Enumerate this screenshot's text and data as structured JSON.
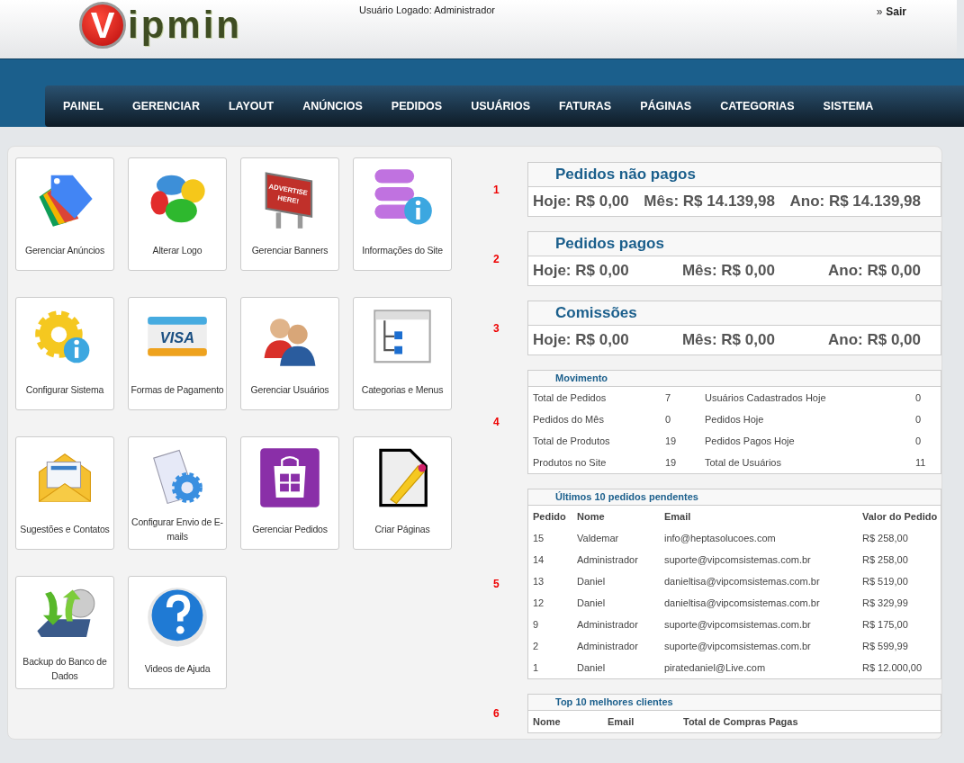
{
  "header": {
    "logo": {
      "mark": "V",
      "text": "ipmin"
    },
    "logged_user": "Usuário Logado: Administrador",
    "logout": {
      "arrow": "»",
      "label": "Sair"
    }
  },
  "nav": [
    {
      "label": "PAINEL"
    },
    {
      "label": "GERENCIAR"
    },
    {
      "label": "LAYOUT"
    },
    {
      "label": "ANÚNCIOS"
    },
    {
      "label": "PEDIDOS"
    },
    {
      "label": "USUÁRIOS"
    },
    {
      "label": "FATURAS"
    },
    {
      "label": "PÁGINAS"
    },
    {
      "label": "CATEGORIAS"
    },
    {
      "label": "SISTEMA"
    }
  ],
  "tiles": [
    {
      "label": "Gerenciar Anúncios",
      "kind": "tag"
    },
    {
      "label": "Alterar Logo",
      "kind": "paint"
    },
    {
      "label": "Gerenciar Banners",
      "kind": "billboard",
      "icon_text": [
        "ADVERTISE",
        "HERE!"
      ]
    },
    {
      "label": "Informações do Site",
      "kind": "database-info"
    },
    {
      "label": "Configurar Sistema",
      "kind": "gear-info"
    },
    {
      "label": "Formas de Pagamento",
      "kind": "card",
      "icon_text": [
        "VISA"
      ]
    },
    {
      "label": "Gerenciar Usuários",
      "kind": "users"
    },
    {
      "label": "Categorias e Menus",
      "kind": "tree-window"
    },
    {
      "label": "Sugestões e Contatos",
      "kind": "envelope"
    },
    {
      "label": "Configurar Envio de E-mails",
      "kind": "document-gear"
    },
    {
      "label": "Gerenciar Pedidos",
      "kind": "store-bag"
    },
    {
      "label": "Criar Páginas",
      "kind": "page-pencil"
    },
    {
      "label": "Backup do Banco de Dados",
      "kind": "disk-backup"
    },
    {
      "label": "Videos de Ajuda",
      "kind": "help"
    }
  ],
  "panels": [
    {
      "number": "1",
      "kind": "totals",
      "title": "Pedidos não pagos",
      "values": [
        "Hoje: R$ 0,00",
        "Mês: R$ 14.139,98",
        "Ano: R$ 14.139,98"
      ]
    },
    {
      "number": "2",
      "kind": "totals",
      "title": "Pedidos pagos",
      "values": [
        "Hoje: R$ 0,00",
        "Mês: R$ 0,00",
        "Ano: R$ 0,00"
      ]
    },
    {
      "number": "3",
      "kind": "totals",
      "title": "Comissões",
      "values": [
        "Hoje: R$ 0,00",
        "Mês: R$ 0,00",
        "Ano: R$ 0,00"
      ]
    },
    {
      "number": "4",
      "kind": "stats",
      "title": "Movimento",
      "rows": [
        [
          "Total de Pedidos",
          "7",
          "Usuários Cadastrados Hoje",
          "0"
        ],
        [
          "Pedidos do Mês",
          "0",
          "Pedidos Hoje",
          "0"
        ],
        [
          "Total de Produtos",
          "19",
          "Pedidos Pagos Hoje",
          "0"
        ],
        [
          "Produtos no Site",
          "19",
          "Total de Usuários",
          "11"
        ]
      ]
    },
    {
      "number": "5",
      "kind": "table",
      "title": "Últimos 10 pedidos pendentes",
      "columns": [
        "Pedido",
        "Nome",
        "Email",
        "Valor do Pedido"
      ],
      "rows": [
        [
          "15",
          "Valdemar",
          "info@heptasolucoes.com",
          "R$ 258,00"
        ],
        [
          "14",
          "Administrador",
          "suporte@vipcomsistemas.com.br",
          "R$ 258,00"
        ],
        [
          "13",
          "Daniel",
          "danieltisa@vipcomsistemas.com.br",
          "R$ 519,00"
        ],
        [
          "12",
          "Daniel",
          "danieltisa@vipcomsistemas.com.br",
          "R$ 329,99"
        ],
        [
          "9",
          "Administrador",
          "suporte@vipcomsistemas.com.br",
          "R$ 175,00"
        ],
        [
          "2",
          "Administrador",
          "suporte@vipcomsistemas.com.br",
          "R$ 599,99"
        ],
        [
          "1",
          "Daniel",
          "piratedaniel@Live.com",
          "R$ 12.000,00"
        ]
      ]
    },
    {
      "number": "6",
      "kind": "table",
      "title": "Top 10 melhores clientes",
      "columns": [
        "Nome",
        "Email",
        "Total de Compras Pagas"
      ]
    }
  ]
}
